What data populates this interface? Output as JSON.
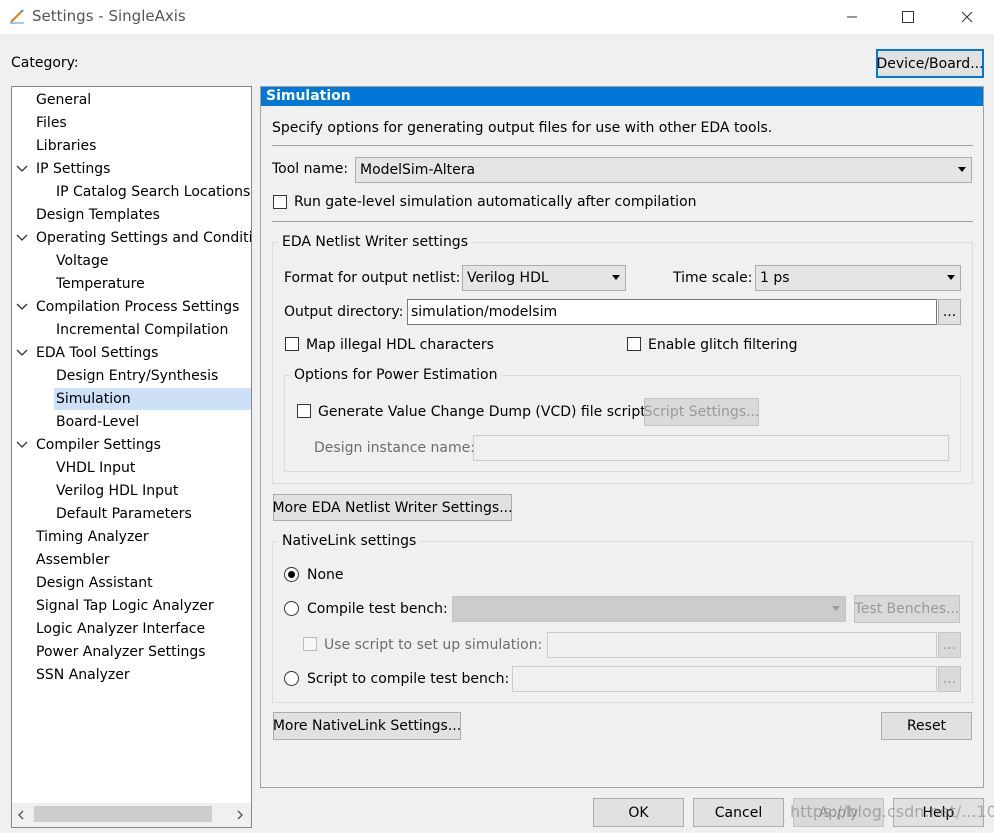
{
  "window": {
    "title": "Settings - SingleAxis",
    "app_icon": "pencil-icon",
    "controls": [
      "minimize-icon",
      "maximize-icon",
      "close-icon"
    ]
  },
  "category_label": "Category:",
  "device_board_button": "Device/Board...",
  "tree": [
    {
      "label": "General",
      "level": 0,
      "expanded": false,
      "selected": false
    },
    {
      "label": "Files",
      "level": 0,
      "expanded": false,
      "selected": false
    },
    {
      "label": "Libraries",
      "level": 0,
      "expanded": false,
      "selected": false
    },
    {
      "label": "IP Settings",
      "level": 0,
      "expanded": true,
      "selected": false
    },
    {
      "label": "IP Catalog Search Locations",
      "level": 1,
      "expanded": false,
      "selected": false
    },
    {
      "label": "Design Templates",
      "level": 0,
      "expanded": false,
      "selected": false
    },
    {
      "label": "Operating Settings and Conditio",
      "level": 0,
      "expanded": true,
      "selected": false
    },
    {
      "label": "Voltage",
      "level": 1,
      "expanded": false,
      "selected": false
    },
    {
      "label": "Temperature",
      "level": 1,
      "expanded": false,
      "selected": false
    },
    {
      "label": "Compilation Process Settings",
      "level": 0,
      "expanded": true,
      "selected": false
    },
    {
      "label": "Incremental Compilation",
      "level": 1,
      "expanded": false,
      "selected": false
    },
    {
      "label": "EDA Tool Settings",
      "level": 0,
      "expanded": true,
      "selected": false
    },
    {
      "label": "Design Entry/Synthesis",
      "level": 1,
      "expanded": false,
      "selected": false
    },
    {
      "label": "Simulation",
      "level": 1,
      "expanded": false,
      "selected": true
    },
    {
      "label": "Board-Level",
      "level": 1,
      "expanded": false,
      "selected": false
    },
    {
      "label": "Compiler Settings",
      "level": 0,
      "expanded": true,
      "selected": false
    },
    {
      "label": "VHDL Input",
      "level": 1,
      "expanded": false,
      "selected": false
    },
    {
      "label": "Verilog HDL Input",
      "level": 1,
      "expanded": false,
      "selected": false
    },
    {
      "label": "Default Parameters",
      "level": 1,
      "expanded": false,
      "selected": false
    },
    {
      "label": "Timing Analyzer",
      "level": 0,
      "expanded": false,
      "selected": false
    },
    {
      "label": "Assembler",
      "level": 0,
      "expanded": false,
      "selected": false
    },
    {
      "label": "Design Assistant",
      "level": 0,
      "expanded": false,
      "selected": false
    },
    {
      "label": "Signal Tap Logic Analyzer",
      "level": 0,
      "expanded": false,
      "selected": false
    },
    {
      "label": "Logic Analyzer Interface",
      "level": 0,
      "expanded": false,
      "selected": false
    },
    {
      "label": "Power Analyzer Settings",
      "level": 0,
      "expanded": false,
      "selected": false
    },
    {
      "label": "SSN Analyzer",
      "level": 0,
      "expanded": false,
      "selected": false
    }
  ],
  "panel": {
    "title": "Simulation",
    "description": "Specify options for generating output files for use with other EDA tools.",
    "tool_name_label": "Tool name:",
    "tool_name_value": "ModelSim-Altera",
    "run_gate_level_label": "Run gate-level simulation automatically after compilation",
    "run_gate_level_checked": false,
    "netlist": {
      "title": "EDA Netlist Writer settings",
      "format_label": "Format for output netlist:",
      "format_value": "Verilog HDL",
      "timescale_label": "Time scale:",
      "timescale_value": "1 ps",
      "output_dir_label": "Output directory:",
      "output_dir_value": "simulation/modelsim",
      "browse_label": "...",
      "map_illegal_label": "Map illegal HDL characters",
      "map_illegal_checked": false,
      "glitch_label": "Enable glitch filtering",
      "glitch_checked": false,
      "power": {
        "title": "Options for Power Estimation",
        "vcd_label": "Generate Value Change Dump (VCD) file script",
        "vcd_checked": false,
        "script_settings_button": "Script Settings...",
        "instance_label": "Design instance name:",
        "instance_value": ""
      }
    },
    "more_netlist_button": "More EDA Netlist Writer Settings...",
    "nativelink": {
      "title": "NativeLink settings",
      "none_label": "None",
      "none_checked": true,
      "compile_tb_label": "Compile test bench:",
      "compile_tb_value": "",
      "test_benches_button": "Test Benches...",
      "use_script_label": "Use script to set up simulation:",
      "use_script_value": "",
      "browse_label": "...",
      "script_compile_label": "Script to compile test bench:",
      "script_compile_value": ""
    },
    "more_nativelink_button": "More NativeLink Settings...",
    "reset_button": "Reset"
  },
  "footer": {
    "ok": "OK",
    "cancel": "Cancel",
    "apply": "Apply",
    "help": "Help"
  },
  "watermark": "https://blog.csdn.net/...10"
}
